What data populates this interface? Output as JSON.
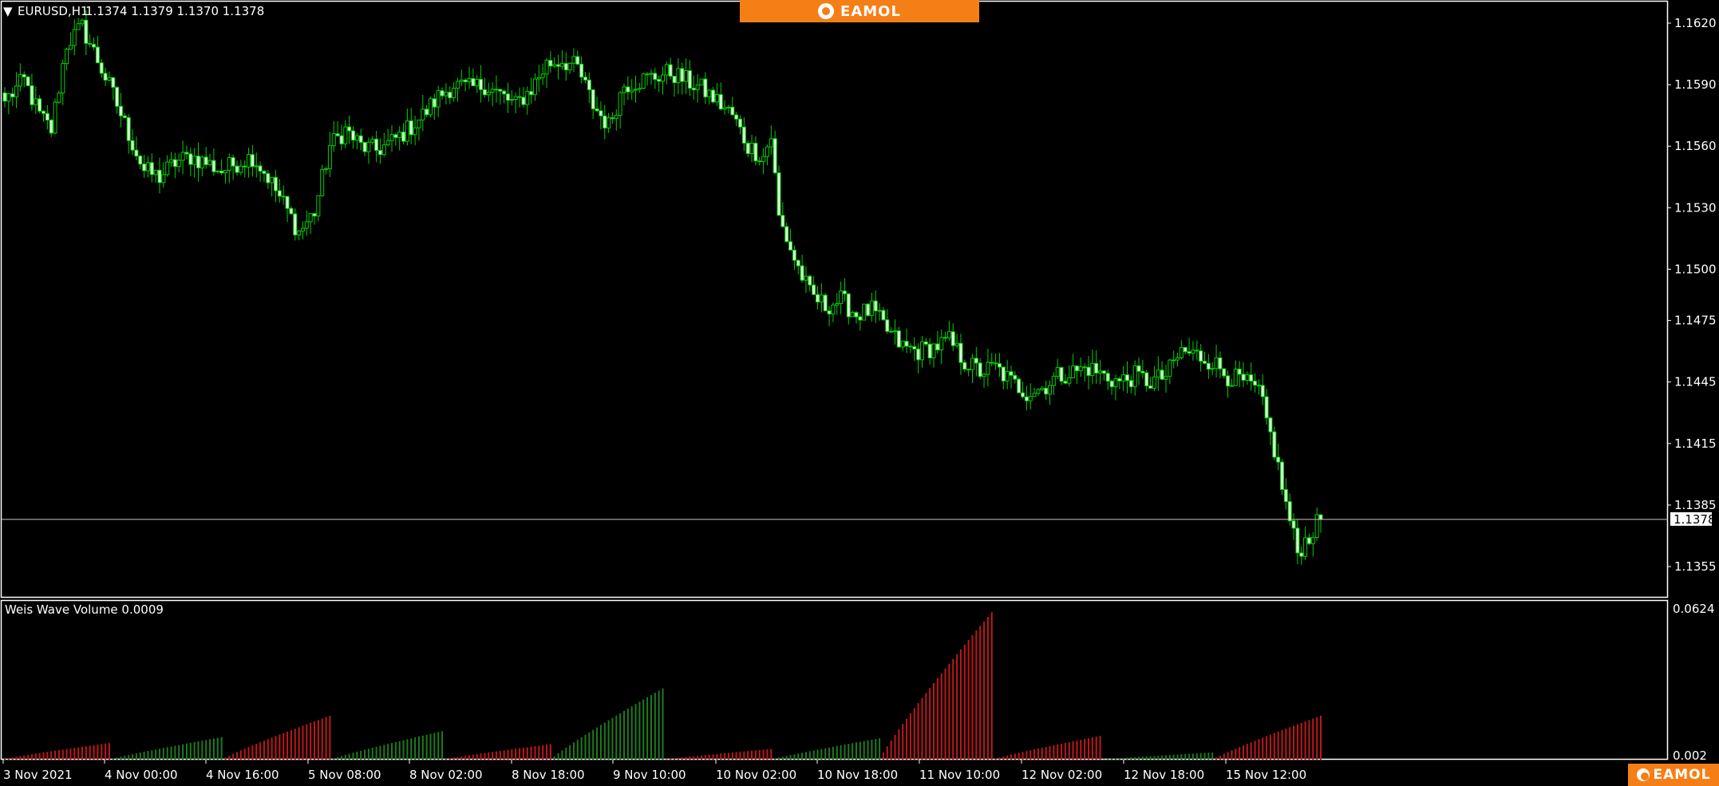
{
  "header": {
    "symbol_label": "EURUSD,H1",
    "ohlc": "1.1374 1.1379 1.1370 1.1378",
    "dropdown_glyph": "▼"
  },
  "brand": {
    "logo_text": "EAMOL",
    "color": "#f57f17"
  },
  "price_axis": {
    "ticks": [
      "1.1620",
      "1.1590",
      "1.1560",
      "1.1530",
      "1.1500",
      "1.1475",
      "1.1445",
      "1.1415",
      "1.1385",
      "1.1355"
    ],
    "current_price": "1.1378"
  },
  "indicator": {
    "label": "Weis Wave Volume 0.0009",
    "axis_ticks": [
      "0.0624",
      "0.002"
    ]
  },
  "time_axis": {
    "ticks": [
      "3 Nov 2021",
      "4 Nov 00:00",
      "4 Nov 16:00",
      "5 Nov 08:00",
      "8 Nov 02:00",
      "8 Nov 18:00",
      "9 Nov 10:00",
      "10 Nov 02:00",
      "10 Nov 18:00",
      "11 Nov 10:00",
      "12 Nov 02:00",
      "12 Nov 18:00",
      "15 Nov 12:00"
    ]
  },
  "colors": {
    "candle_up": "#00d000",
    "candle_down_body": "#d8ffd8",
    "volume_up": "#1f7a1f",
    "volume_down": "#c01818",
    "grid_line": "#c8c8c8"
  },
  "chart_data": {
    "type": "candlestick",
    "symbol": "EURUSD",
    "timeframe": "H1",
    "y_range": [
      1.1345,
      1.1632
    ],
    "close_path": [
      [
        0,
        1.1582
      ],
      [
        5,
        1.1592
      ],
      [
        9,
        1.1575
      ],
      [
        12,
        1.1568
      ],
      [
        16,
        1.161
      ],
      [
        20,
        1.1618
      ],
      [
        24,
        1.1602
      ],
      [
        28,
        1.1585
      ],
      [
        32,
        1.1566
      ],
      [
        36,
        1.1548
      ],
      [
        40,
        1.1545
      ],
      [
        44,
        1.1552
      ],
      [
        48,
        1.1555
      ],
      [
        52,
        1.1552
      ],
      [
        56,
        1.1548
      ],
      [
        60,
        1.1552
      ],
      [
        64,
        1.1555
      ],
      [
        68,
        1.1545
      ],
      [
        72,
        1.1532
      ],
      [
        76,
        1.1518
      ],
      [
        80,
        1.1528
      ],
      [
        84,
        1.156
      ],
      [
        88,
        1.1568
      ],
      [
        92,
        1.156
      ],
      [
        96,
        1.1558
      ],
      [
        100,
        1.1562
      ],
      [
        104,
        1.1568
      ],
      [
        108,
        1.1575
      ],
      [
        112,
        1.1584
      ],
      [
        116,
        1.159
      ],
      [
        120,
        1.1588
      ],
      [
        124,
        1.159
      ],
      [
        128,
        1.1585
      ],
      [
        132,
        1.158
      ],
      [
        136,
        1.1588
      ],
      [
        140,
        1.16
      ],
      [
        144,
        1.1602
      ],
      [
        148,
        1.1598
      ],
      [
        152,
        1.158
      ],
      [
        156,
        1.157
      ],
      [
        160,
        1.159
      ],
      [
        164,
        1.1592
      ],
      [
        168,
        1.1594
      ],
      [
        172,
        1.1596
      ],
      [
        176,
        1.1592
      ],
      [
        180,
        1.1588
      ],
      [
        184,
        1.1582
      ],
      [
        188,
        1.1575
      ],
      [
        192,
        1.156
      ],
      [
        196,
        1.1555
      ],
      [
        198,
        1.1565
      ],
      [
        200,
        1.1525
      ],
      [
        204,
        1.1505
      ],
      [
        208,
        1.1488
      ],
      [
        212,
        1.1482
      ],
      [
        216,
        1.1485
      ],
      [
        220,
        1.1478
      ],
      [
        224,
        1.148
      ],
      [
        228,
        1.147
      ],
      [
        232,
        1.1462
      ],
      [
        236,
        1.146
      ],
      [
        240,
        1.1462
      ],
      [
        244,
        1.1465
      ],
      [
        248,
        1.1455
      ],
      [
        252,
        1.145
      ],
      [
        256,
        1.1452
      ],
      [
        260,
        1.1445
      ],
      [
        264,
        1.144
      ],
      [
        268,
        1.1442
      ],
      [
        272,
        1.1448
      ],
      [
        276,
        1.145
      ],
      [
        280,
        1.1452
      ],
      [
        284,
        1.1448
      ],
      [
        288,
        1.1445
      ],
      [
        292,
        1.1448
      ],
      [
        296,
        1.1445
      ],
      [
        300,
        1.1448
      ],
      [
        304,
        1.146
      ],
      [
        308,
        1.1458
      ],
      [
        312,
        1.1455
      ],
      [
        316,
        1.1448
      ],
      [
        320,
        1.1445
      ],
      [
        324,
        1.144
      ],
      [
        328,
        1.1412
      ],
      [
        331,
        1.1385
      ],
      [
        334,
        1.1362
      ],
      [
        337,
        1.137
      ],
      [
        340,
        1.1378
      ]
    ],
    "volume_waves": [
      {
        "direction": "down",
        "peak": 0.007
      },
      {
        "direction": "up",
        "peak": 0.0095
      },
      {
        "direction": "down",
        "peak": 0.0185
      },
      {
        "direction": "up",
        "peak": 0.012
      },
      {
        "direction": "down",
        "peak": 0.0065
      },
      {
        "direction": "up",
        "peak": 0.03
      },
      {
        "direction": "down",
        "peak": 0.0045
      },
      {
        "direction": "up",
        "peak": 0.009
      },
      {
        "direction": "down",
        "peak": 0.062
      },
      {
        "direction": "down",
        "peak": 0.01
      },
      {
        "direction": "up",
        "peak": 0.003
      },
      {
        "direction": "down",
        "peak": 0.0185
      }
    ]
  }
}
